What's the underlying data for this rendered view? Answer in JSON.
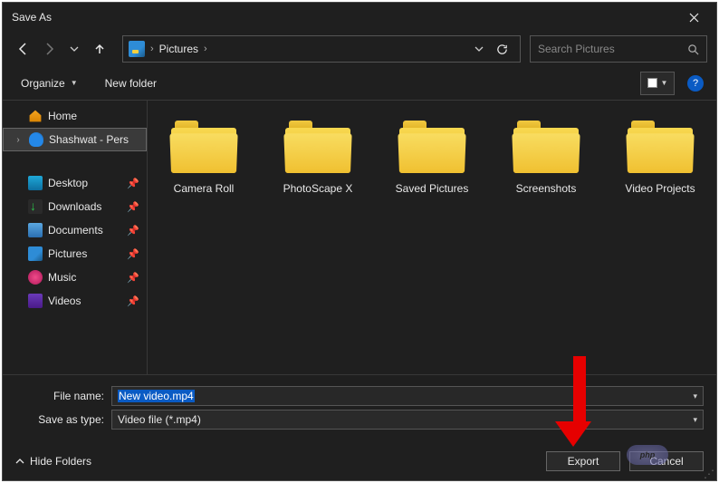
{
  "window": {
    "title": "Save As"
  },
  "address": {
    "location": "Pictures"
  },
  "search": {
    "placeholder": "Search Pictures"
  },
  "toolbar": {
    "organize": "Organize",
    "new_folder": "New folder"
  },
  "sidebar": {
    "home": "Home",
    "personal": "Shashwat - Pers",
    "desktop": "Desktop",
    "downloads": "Downloads",
    "documents": "Documents",
    "pictures": "Pictures",
    "music": "Music",
    "videos": "Videos"
  },
  "folders": [
    {
      "name": "Camera Roll"
    },
    {
      "name": "PhotoScape X"
    },
    {
      "name": "Saved Pictures"
    },
    {
      "name": "Screenshots"
    },
    {
      "name": "Video Projects"
    }
  ],
  "form": {
    "filename_label": "File name:",
    "filename_value": "New video.mp4",
    "type_label": "Save as type:",
    "type_value": "Video file (*.mp4)"
  },
  "buttons": {
    "hide_folders": "Hide Folders",
    "export": "Export",
    "cancel": "Cancel"
  }
}
